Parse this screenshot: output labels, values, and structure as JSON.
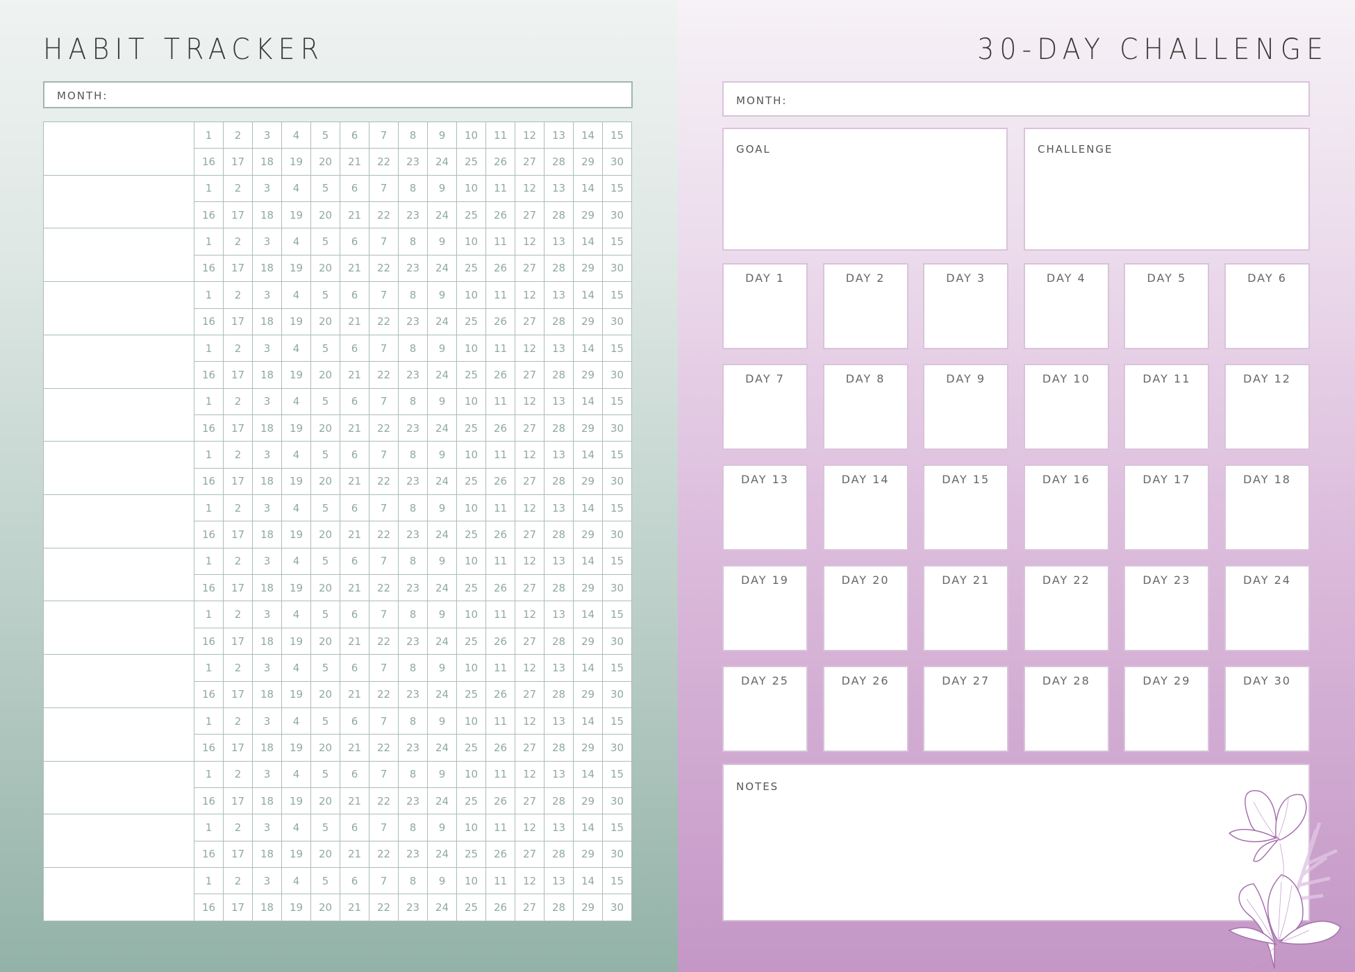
{
  "habit_tracker": {
    "title": "HABIT TRACKER",
    "month_label": "MONTH:",
    "row_count": 15,
    "first_half_days": [
      "1",
      "2",
      "3",
      "4",
      "5",
      "6",
      "7",
      "8",
      "9",
      "10",
      "11",
      "12",
      "13",
      "14",
      "15"
    ],
    "second_half_days": [
      "16",
      "17",
      "18",
      "19",
      "20",
      "21",
      "22",
      "23",
      "24",
      "25",
      "26",
      "27",
      "28",
      "29",
      "30"
    ]
  },
  "challenge": {
    "title": "30-DAY CHALLENGE",
    "month_label": "MONTH:",
    "goal_label": "GOAL",
    "challenge_label": "CHALLENGE",
    "notes_label": "NOTES",
    "days": [
      "DAY 1",
      "DAY 2",
      "DAY 3",
      "DAY 4",
      "DAY 5",
      "DAY 6",
      "DAY 7",
      "DAY 8",
      "DAY 9",
      "DAY 10",
      "DAY 11",
      "DAY 12",
      "DAY 13",
      "DAY 14",
      "DAY 15",
      "DAY 16",
      "DAY 17",
      "DAY 18",
      "DAY 19",
      "DAY 20",
      "DAY 21",
      "DAY 22",
      "DAY 23",
      "DAY 24",
      "DAY 25",
      "DAY 26",
      "DAY 27",
      "DAY 28",
      "DAY 29",
      "DAY 30"
    ],
    "decoration": "flower-illustration"
  },
  "colors": {
    "left_accent": "#9fb6ae",
    "right_accent": "#c497c6",
    "number_color": "#8fa9a0"
  }
}
